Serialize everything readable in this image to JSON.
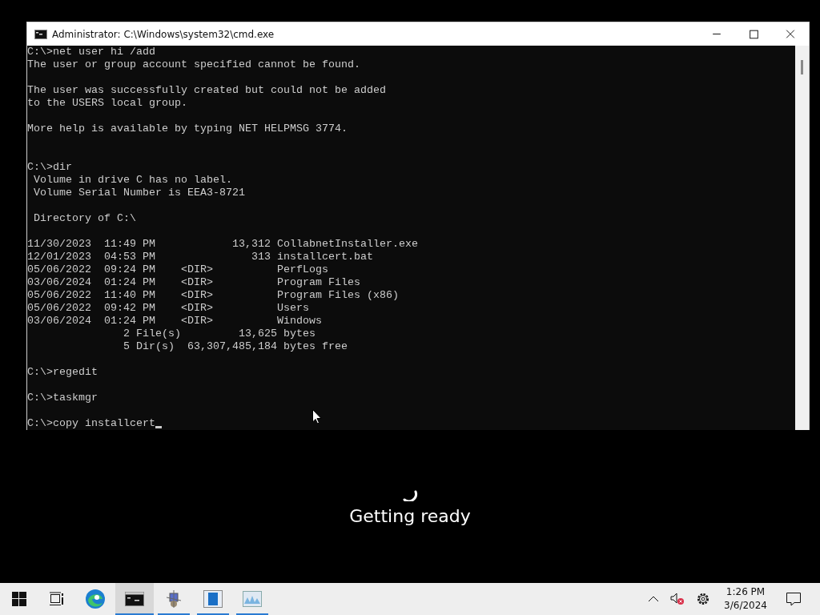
{
  "window": {
    "title": "Administrator: C:\\Windows\\system32\\cmd.exe"
  },
  "console": {
    "cursor": true,
    "blocks": [
      {
        "blank_after": true,
        "wide_gap": false,
        "lines": [
          "C:\\>net user hi /add",
          "The user or group account specified cannot be found."
        ]
      },
      {
        "blank_after": true,
        "wide_gap": false,
        "lines": [
          "The user was successfully created but could not be added",
          "to the USERS local group."
        ]
      },
      {
        "blank_after": true,
        "wide_gap": true,
        "lines": [
          "More help is available by typing NET HELPMSG 3774."
        ]
      },
      {
        "blank_after": true,
        "wide_gap": false,
        "lines": [
          "C:\\>dir",
          " Volume in drive C has no label.",
          " Volume Serial Number is EEA3-8721"
        ]
      },
      {
        "blank_after": true,
        "wide_gap": false,
        "lines": [
          " Directory of C:\\"
        ]
      },
      {
        "blank_after": true,
        "wide_gap": false,
        "lines": [
          "11/30/2023  11:49 PM            13,312 CollabnetInstaller.exe",
          "12/01/2023  04:53 PM               313 installcert.bat",
          "05/06/2022  09:24 PM    <DIR>          PerfLogs",
          "03/06/2024  01:24 PM    <DIR>          Program Files",
          "05/06/2022  11:40 PM    <DIR>          Program Files (x86)",
          "05/06/2022  09:42 PM    <DIR>          Users",
          "03/06/2024  01:24 PM    <DIR>          Windows",
          "               2 File(s)         13,625 bytes",
          "               5 Dir(s)  63,307,485,184 bytes free"
        ]
      },
      {
        "blank_after": true,
        "wide_gap": false,
        "lines": [
          "C:\\>regedit"
        ]
      },
      {
        "blank_after": true,
        "wide_gap": false,
        "lines": [
          "C:\\>taskmgr"
        ]
      },
      {
        "blank_after": false,
        "wide_gap": false,
        "lines": [
          "C:\\>copy installcert"
        ]
      }
    ]
  },
  "status": {
    "text": "Getting ready"
  },
  "taskbar": {
    "apps": [
      {
        "kind": "edge",
        "running": false,
        "selected": false
      },
      {
        "kind": "cmd",
        "running": true,
        "selected": true
      },
      {
        "kind": "network",
        "running": true,
        "selected": false
      },
      {
        "kind": "regedit",
        "running": true,
        "selected": false
      },
      {
        "kind": "monitor",
        "running": true,
        "selected": false
      }
    ],
    "clock": {
      "time": "1:26 PM",
      "date": "3/6/2024"
    }
  }
}
